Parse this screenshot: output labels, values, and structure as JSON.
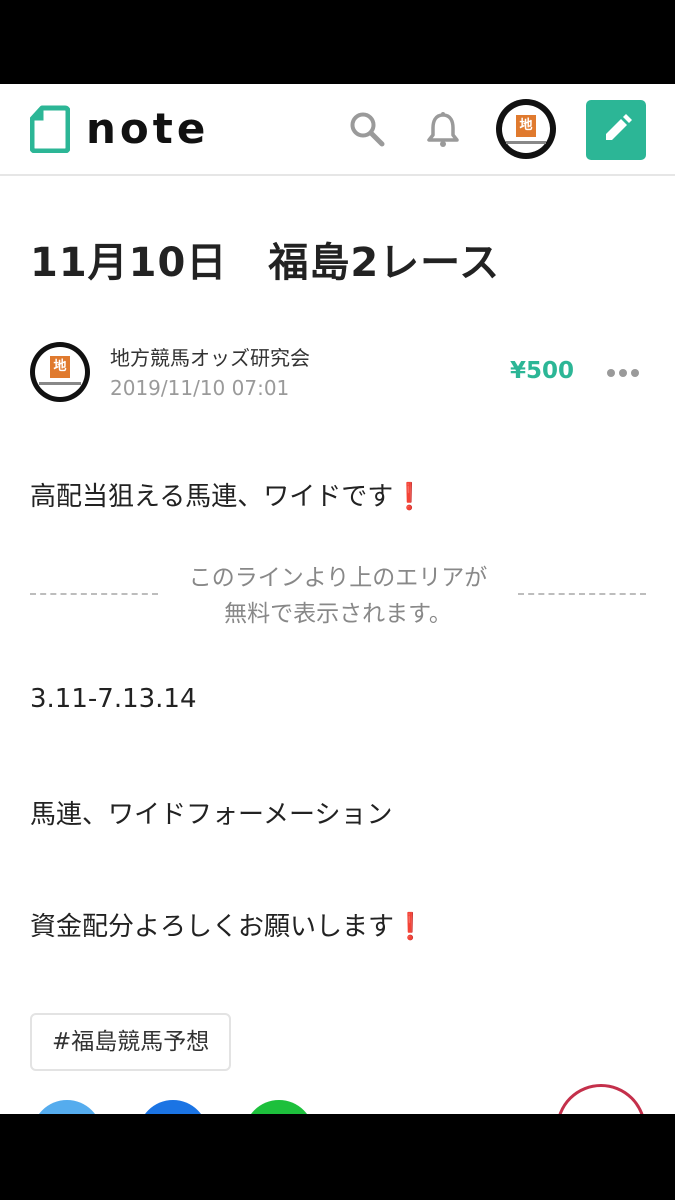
{
  "header": {
    "logo_text": "note",
    "avatar_badge": "地",
    "brand_color": "#2cb696"
  },
  "article": {
    "title": "11月10日　福島2レース",
    "author": "地方競馬オッズ研究会",
    "date": "2019/11/10 07:01",
    "price": "¥500",
    "intro": "高配当狙える馬連、ワイドです",
    "paywall_line1": "このラインより上のエリアが",
    "paywall_line2": "無料で表示されます。",
    "numbers": "3.11-7.13.14",
    "bet_type": "馬連、ワイドフォーメーション",
    "closing": "資金配分よろしくお願いします",
    "exclaim": "❗",
    "tag": "#福島競馬予想"
  },
  "icons": [
    "note-logo-icon",
    "search-icon",
    "bell-icon",
    "pencil-icon",
    "more-icon",
    "twitter-icon",
    "facebook-icon",
    "line-icon",
    "heart-icon"
  ]
}
